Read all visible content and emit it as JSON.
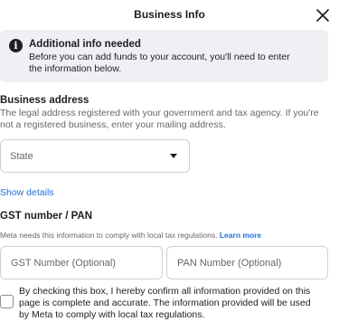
{
  "header": {
    "title": "Business Info",
    "close_icon": "close-icon"
  },
  "notice": {
    "icon": "info-icon",
    "title": "Additional info needed",
    "body": "Before you can add funds to your account, you'll need to enter the information below."
  },
  "business_address": {
    "title": "Business address",
    "description": "The legal address registered with your government and tax agency. If you're not a registered business, enter your mailing address.",
    "state_select": {
      "value": "State"
    },
    "show_details": "Show details"
  },
  "gst": {
    "title": "GST number / PAN",
    "description": "Meta needs this information to comply with local tax regulations.",
    "learn_more": "Learn more",
    "gst_placeholder": "GST Number (Optional)",
    "pan_placeholder": "PAN Number (Optional)"
  },
  "consent": {
    "checked": false,
    "text": "By checking this box, I hereby confirm all information provided on this page is complete and accurate. The information provided will be used by Meta to comply with local tax regulations."
  }
}
